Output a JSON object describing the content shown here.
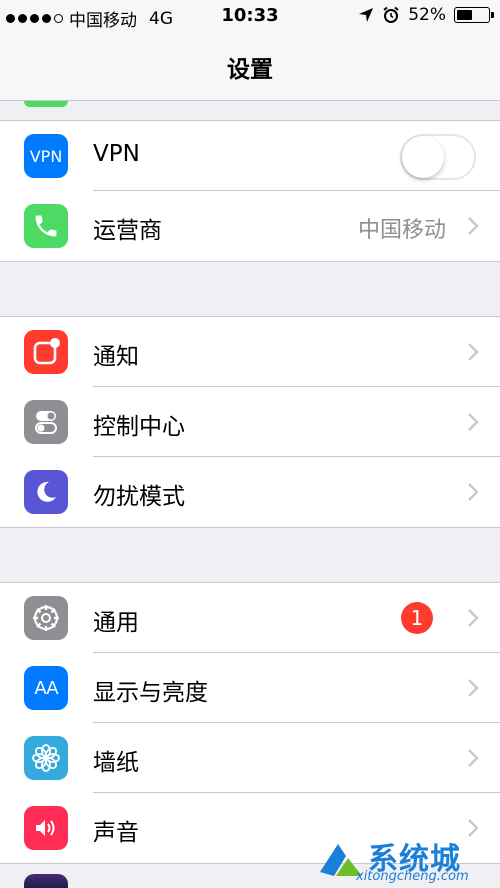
{
  "status": {
    "carrier": "中国移动",
    "network": "4G",
    "time": "10:33",
    "battery_percent": "52%",
    "battery_level": 0.52,
    "icons": [
      "signal-dots-icon",
      "location-arrow-icon",
      "alarm-clock-icon",
      "battery-icon"
    ]
  },
  "nav": {
    "title": "设置"
  },
  "groups": [
    {
      "rows": [
        {
          "icon": "vpn-icon",
          "icon_text": "VPN",
          "icon_color": "#007aff",
          "label": "VPN",
          "control": "toggle",
          "toggle_on": false
        },
        {
          "icon": "phone-icon",
          "icon_color": "#4cd964",
          "label": "运营商",
          "value": "中国移动",
          "control": "chevron"
        }
      ]
    },
    {
      "rows": [
        {
          "icon": "notifications-icon",
          "icon_color": "#ff3b30",
          "label": "通知",
          "control": "chevron"
        },
        {
          "icon": "control-center-icon",
          "icon_color": "#8e8e93",
          "label": "控制中心",
          "control": "chevron"
        },
        {
          "icon": "moon-icon",
          "icon_color": "#5856d6",
          "label": "勿扰模式",
          "control": "chevron"
        }
      ]
    },
    {
      "rows": [
        {
          "icon": "gear-icon",
          "icon_color": "#8e8e93",
          "label": "通用",
          "badge": "1",
          "control": "chevron"
        },
        {
          "icon": "display-brightness-icon",
          "icon_text": "AA",
          "icon_color": "#007aff",
          "label": "显示与亮度",
          "control": "chevron"
        },
        {
          "icon": "wallpaper-flower-icon",
          "icon_color": "#34aadc",
          "label": "墙纸",
          "control": "chevron"
        },
        {
          "icon": "speaker-icon",
          "icon_color": "#ff2d55",
          "label": "声音",
          "control": "chevron"
        }
      ]
    }
  ],
  "watermark": {
    "brand": "系统城",
    "url": "xitongcheng.com"
  }
}
